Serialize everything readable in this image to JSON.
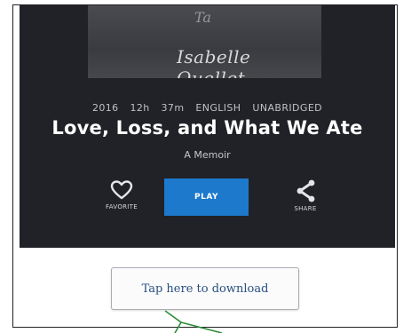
{
  "book": {
    "cover_script": "Ta",
    "cover_author": "Isabelle Ouellet-Lafontaine",
    "year": "2016",
    "duration": "12h 37m",
    "language": "ENGLISH",
    "edition": "UNABRIDGED",
    "title": "Love, Loss, and What We Ate",
    "subtitle": "A Memoir"
  },
  "actions": {
    "favorite_label": "FAVORITE",
    "play_label": "PLAY",
    "share_label": "SHARE"
  },
  "download": {
    "label": "Tap here to download"
  },
  "colors": {
    "player_bg": "#202227",
    "play_button": "#1d79cc",
    "annotation_arrow": "#2e8b3a"
  }
}
